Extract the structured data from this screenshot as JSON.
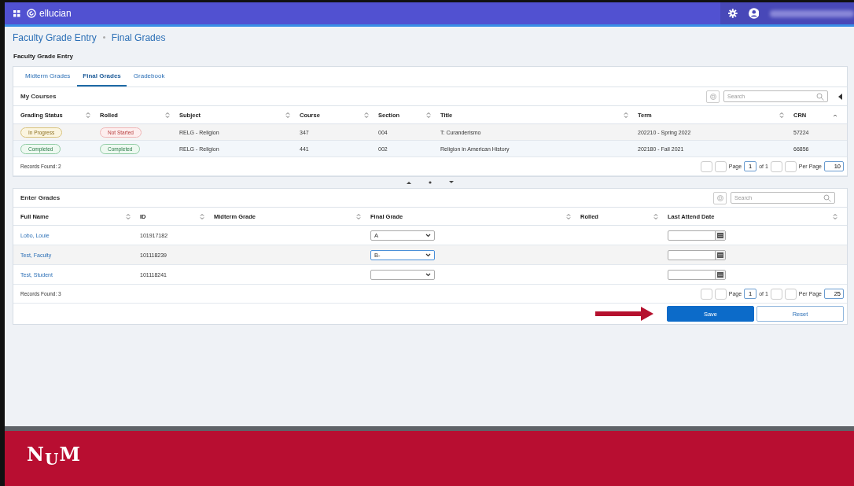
{
  "header": {
    "brand": "ellucian"
  },
  "breadcrumb": [
    "Faculty Grade Entry",
    "Final Grades"
  ],
  "page_title": "Faculty Grade Entry",
  "tabs": [
    {
      "label": "Midterm Grades",
      "selected": false
    },
    {
      "label": "Final Grades",
      "selected": true
    },
    {
      "label": "Gradebook",
      "selected": false
    }
  ],
  "my_courses": {
    "title": "My Courses",
    "search": {
      "placeholder": "Search"
    },
    "columns": [
      "Grading Status",
      "Rolled",
      "Subject",
      "Course",
      "Section",
      "Title",
      "Term",
      "CRN"
    ],
    "rows": [
      {
        "grading_status": {
          "label": "In Progress",
          "kind": "progress"
        },
        "rolled": {
          "label": "Not Started",
          "kind": "not-started"
        },
        "subject": "RELG - Religion",
        "course": "347",
        "section": "004",
        "title": "T: Curanderismo",
        "term": "202210 - Spring 2022",
        "crn": "57224"
      },
      {
        "grading_status": {
          "label": "Completed",
          "kind": "completed"
        },
        "rolled": {
          "label": "Completed",
          "kind": "completed"
        },
        "subject": "RELG - Religion",
        "course": "441",
        "section": "002",
        "title": "Religion in American History",
        "term": "202180 - Fall 2021",
        "crn": "66856"
      }
    ],
    "records_found": "Records Found: 2",
    "pager": {
      "page_label": "Page",
      "page": "1",
      "of": "of 1",
      "per_page_label": "Per Page",
      "per_page": "10"
    }
  },
  "enter_grades": {
    "title": "Enter Grades",
    "search": {
      "placeholder": "Search"
    },
    "columns": [
      "Full Name",
      "ID",
      "Midterm Grade",
      "Final Grade",
      "Rolled",
      "Last Attend Date"
    ],
    "rows": [
      {
        "name": "Lobo, Louie",
        "id": "101917182",
        "final_grade": "A",
        "selected": false
      },
      {
        "name": "Test, Faculty",
        "id": "101118239",
        "final_grade": "B-",
        "selected": true
      },
      {
        "name": "Test, Student",
        "id": "101118241",
        "selected": false
      }
    ],
    "records_found": "Records Found: 3",
    "pager": {
      "page_label": "Page",
      "page": "1",
      "of": "of 1",
      "per_page_label": "Per Page",
      "per_page": "25"
    }
  },
  "buttons": [
    {
      "label": "Save",
      "kind": "primary"
    },
    {
      "label": "Reset",
      "kind": "secondary"
    }
  ],
  "footer": {
    "logo": [
      "N",
      "U",
      "M"
    ]
  }
}
